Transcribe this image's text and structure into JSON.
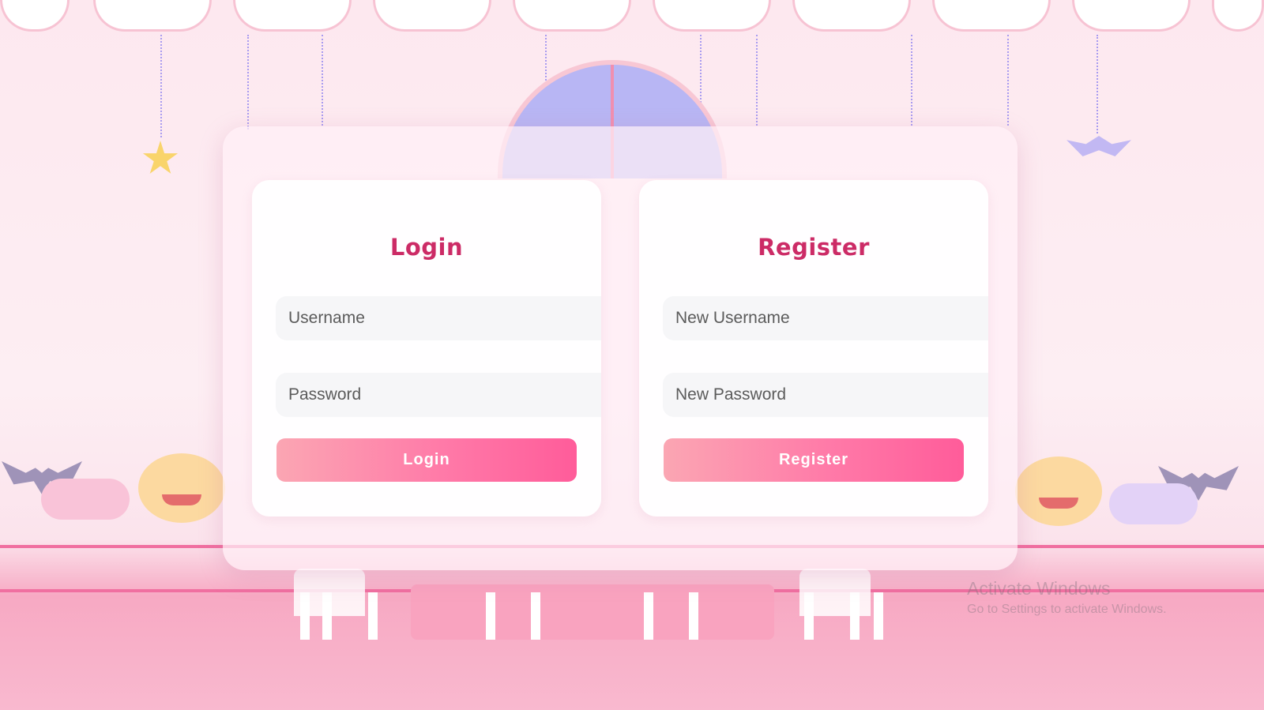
{
  "login": {
    "title": "Login",
    "username_placeholder": "Username",
    "password_placeholder": "Password",
    "button_label": "Login"
  },
  "register": {
    "title": "Register",
    "username_placeholder": "New Username",
    "password_placeholder": "New Password",
    "button_label": "Register"
  },
  "watermark": {
    "title": "Activate Windows",
    "subtitle": "Go to Settings to activate Windows."
  },
  "colors": {
    "title": "#cc2b66",
    "button_start": "#fba6b3",
    "button_end": "#ff5c9a",
    "background": "#fde8ef"
  },
  "icons": [
    "star-icon",
    "bat-icon",
    "pumpkin-icon",
    "candy-icon"
  ]
}
